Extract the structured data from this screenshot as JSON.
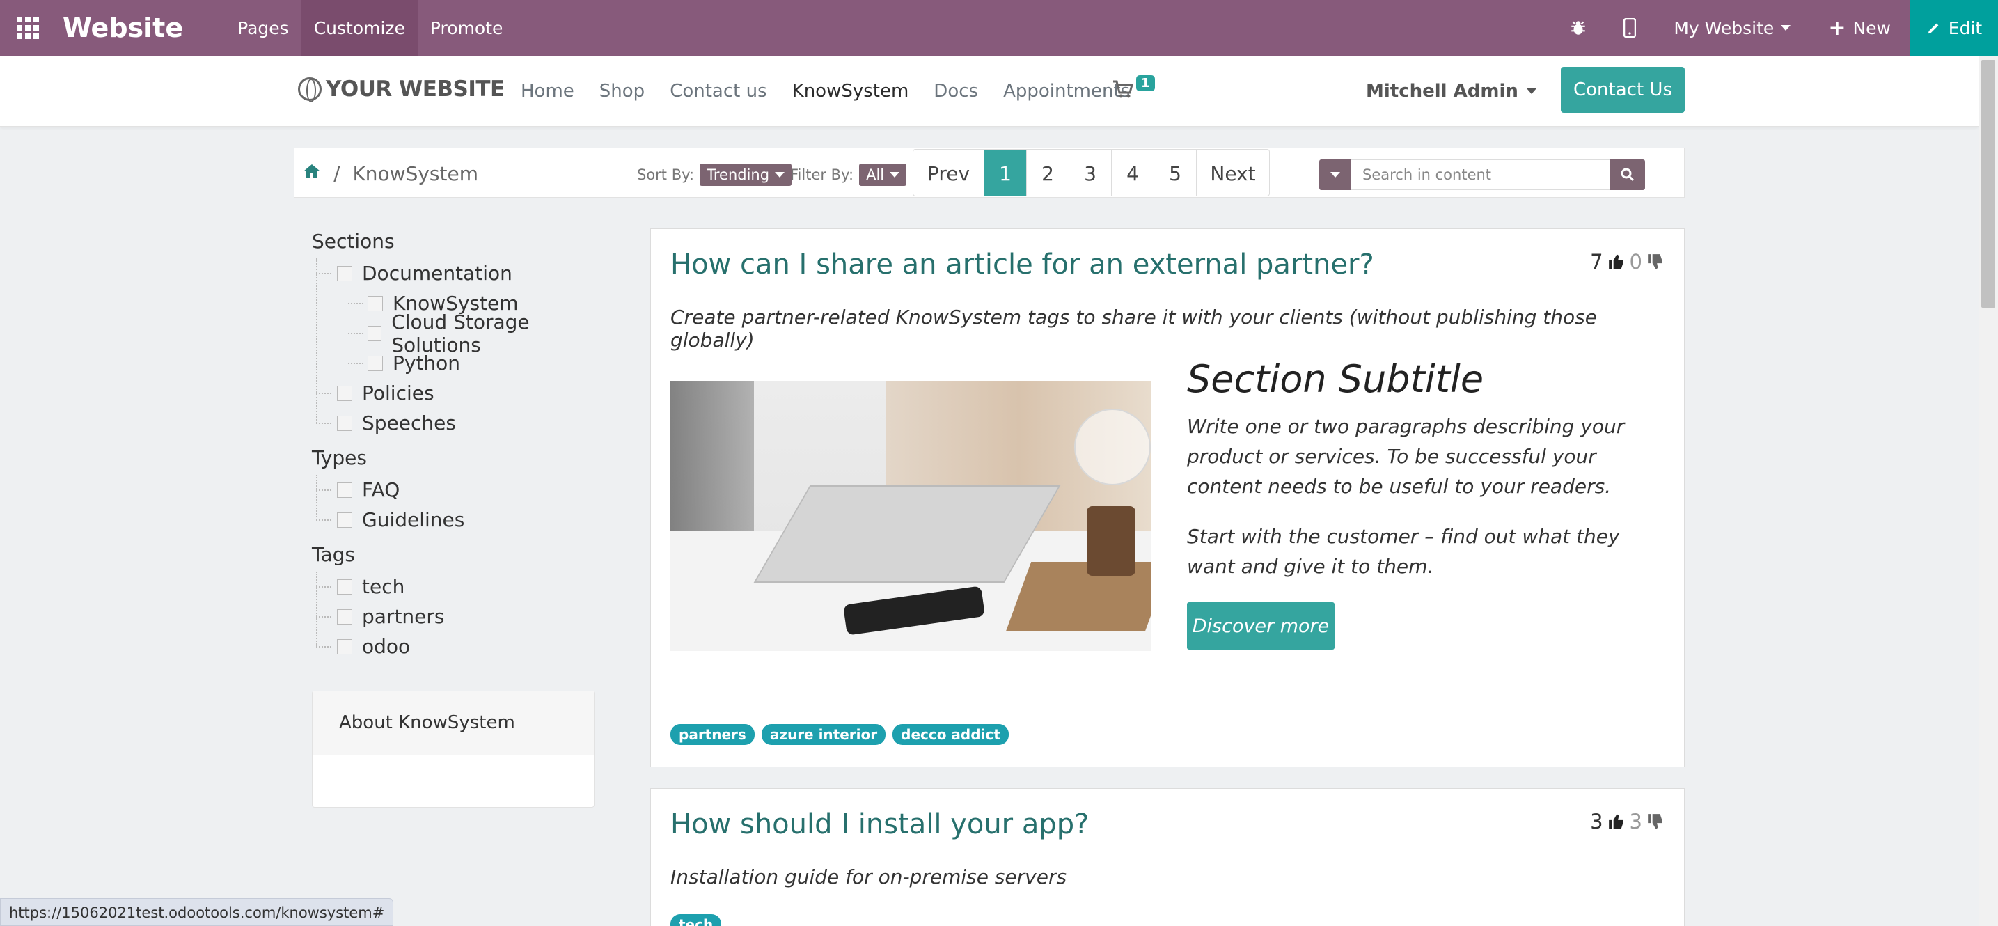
{
  "editor_bar": {
    "app_name": "Website",
    "menu": [
      "Pages",
      "Customize",
      "Promote"
    ],
    "website_switcher": "My Website",
    "new_label": "New",
    "edit_label": "Edit"
  },
  "site_header": {
    "logo_text": "YOUR WEBSITE",
    "nav": [
      "Home",
      "Shop",
      "Contact us",
      "KnowSystem",
      "Docs",
      "Appointments"
    ],
    "cart_count": "1",
    "user": "Mitchell Admin",
    "contact_button": "Contact Us"
  },
  "toolbar": {
    "breadcrumb_current": "KnowSystem",
    "sort_label": "Sort By:",
    "sort_value": "Trending",
    "filter_label": "Filter By:",
    "filter_value": "All",
    "pager": {
      "prev": "Prev",
      "pages": [
        "1",
        "2",
        "3",
        "4",
        "5"
      ],
      "next": "Next",
      "current": "1"
    },
    "search_placeholder": "Search in content"
  },
  "sidebar": {
    "sections_title": "Sections",
    "sections": [
      "Documentation",
      "KnowSystem",
      "Cloud Storage Solutions",
      "Python",
      "Policies",
      "Speeches"
    ],
    "types_title": "Types",
    "types": [
      "FAQ",
      "Guidelines"
    ],
    "tags_title": "Tags",
    "tags": [
      "tech",
      "partners",
      "odoo"
    ],
    "about_title": "About KnowSystem"
  },
  "articles": [
    {
      "title": "How can I share an article for an external partner?",
      "likes": "7",
      "dislikes": "0",
      "description": "Create partner-related KnowSystem tags to share it with your clients (without publishing those globally)",
      "section_subtitle": "Section Subtitle",
      "paragraph_1": "Write one or two paragraphs describing your product or services. To be successful your content needs to be useful to your readers.",
      "paragraph_2": "Start with the customer – find out what they want and give it to them.",
      "button": "Discover more",
      "tags": [
        "partners",
        "azure interior",
        "decco addict"
      ]
    },
    {
      "title": "How should I install your app?",
      "likes": "3",
      "dislikes": "3",
      "description": "Installation guide for on-premise servers",
      "tags": [
        "tech"
      ]
    }
  ],
  "status_url": "https://15062021test.odootools.com/knowsystem#",
  "colors": {
    "odoo_purple": "#875a7b",
    "teal": "#35a59f",
    "edit_teal": "#00a09d",
    "tag": "#1da0ae"
  }
}
